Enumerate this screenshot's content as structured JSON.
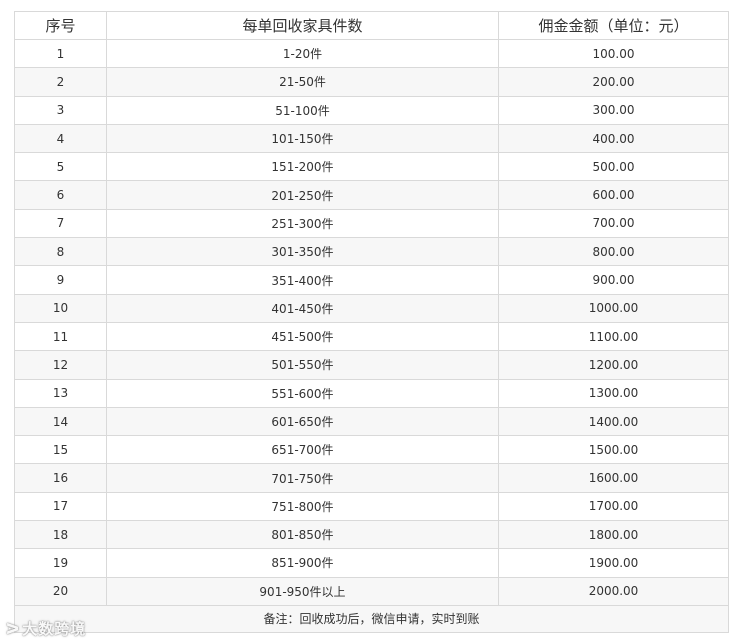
{
  "table": {
    "headers": [
      "序号",
      "每单回收家具件数",
      "佣金金额（单位：元）"
    ],
    "rows": [
      [
        "1",
        "1-20件",
        "100.00"
      ],
      [
        "2",
        "21-50件",
        "200.00"
      ],
      [
        "3",
        "51-100件",
        "300.00"
      ],
      [
        "4",
        "101-150件",
        "400.00"
      ],
      [
        "5",
        "151-200件",
        "500.00"
      ],
      [
        "6",
        "201-250件",
        "600.00"
      ],
      [
        "7",
        "251-300件",
        "700.00"
      ],
      [
        "8",
        "301-350件",
        "800.00"
      ],
      [
        "9",
        "351-400件",
        "900.00"
      ],
      [
        "10",
        "401-450件",
        "1000.00"
      ],
      [
        "11",
        "451-500件",
        "1100.00"
      ],
      [
        "12",
        "501-550件",
        "1200.00"
      ],
      [
        "13",
        "551-600件",
        "1300.00"
      ],
      [
        "14",
        "601-650件",
        "1400.00"
      ],
      [
        "15",
        "651-700件",
        "1500.00"
      ],
      [
        "16",
        "701-750件",
        "1600.00"
      ],
      [
        "17",
        "751-800件",
        "1700.00"
      ],
      [
        "18",
        "801-850件",
        "1800.00"
      ],
      [
        "19",
        "851-900件",
        "1900.00"
      ],
      [
        "20",
        "901-950件以上",
        "2000.00"
      ]
    ],
    "footnote": "备注：回收成功后，微信申请，实时到账"
  },
  "watermark": {
    "text": "大数跨境",
    "icon": "brand-logo-icon"
  }
}
